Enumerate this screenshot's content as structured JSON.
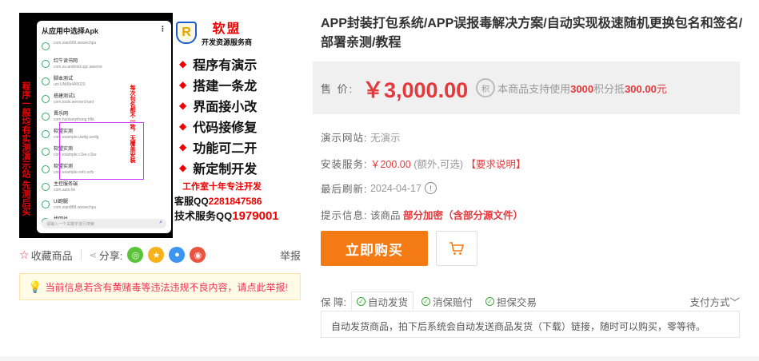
{
  "image": {
    "phone_title": "从应用中选择Apk",
    "apps": [
      {
        "name": "",
        "pkg": "com.xian666.wewechpu"
      },
      {
        "name": "红牛读书网",
        "pkg": "com.ss.android.ugc.aweme"
      },
      {
        "name": "脚本测试",
        "pkg": "uni.UNI6b4A5020"
      },
      {
        "name": "搭建测试1",
        "pkg": "com.tools.wemerchant"
      },
      {
        "name": "晋乐网",
        "pkg": "com.huixianyihong.hftk"
      },
      {
        "name": "软盟实测",
        "pkg": "com.example.uwdg.uwdg"
      },
      {
        "name": "软盟实测",
        "pkg": "com.example.c1ke.c1ke"
      },
      {
        "name": "软盟实测",
        "pkg": "com.example.svfz.svfz"
      },
      {
        "name": "主控服务端",
        "pkg": "com.auto.kk"
      },
      {
        "name": "UI跑腿",
        "pkg": "com.xian888.wewechpu"
      },
      {
        "name": "找回丝",
        "pkg": "com.taobao.sfefiah"
      }
    ],
    "phone_search": "请输入一个关键字进行搜索",
    "left_vertical": "程序一般均有实测演示站 先测后买",
    "right_vertical": "每次包名都不一致，无覆盖安装",
    "brand_name": "软盟",
    "brand_sub": "开发资源服务商",
    "promo_items": [
      "程序有演示",
      "搭建一条龙",
      "界面接小改",
      "代码接修复",
      "功能可二开",
      "新定制开发"
    ],
    "studio": "工作室十年专注开发",
    "kefu_label": "客服QQ",
    "kefu_qq": "2281847586",
    "jishu_label": "技术服务QQ",
    "jishu_qq": "1979001"
  },
  "actions": {
    "favorite": "收藏商品",
    "share": "分享:",
    "report": "举报",
    "warning": "当前信息若含有黄赌毒等违法违规不良内容，请点此举报!"
  },
  "product": {
    "title": "APP封装打包系统/APP误报毒解决方案/自动实现极速随机更换包名和签名/部署亲测/教程",
    "price_label": "售 价:",
    "price": "￥3,000.00",
    "points_icon": "积",
    "points_pre": "本商品支持使用",
    "points_amount": "3000",
    "points_mid": "积分抵",
    "points_value": "300.00",
    "points_suffix": "元",
    "demo_label": "演示网站:",
    "demo_value": "无演示",
    "install_label": "安装服务:",
    "install_price": "￥200.00",
    "install_note": "(额外,可选)",
    "install_link": "【要求说明】",
    "refresh_label": "最后刷新:",
    "refresh_value": "2024-04-17",
    "tip_label": "提示信息:",
    "tip_pre": "该商品",
    "tip_value": "部分加密（含部分源文件）",
    "buy_label": "立即购买",
    "guarantee_label": "保 障:",
    "guarantees": [
      "自动发货",
      "消保赔付",
      "担保交易"
    ],
    "pay_label": "支付方式",
    "guarantee_desc": "自动发货商品，拍下后系统会自动发送商品发货（下载）链接，随时可以购买，零等待。"
  }
}
